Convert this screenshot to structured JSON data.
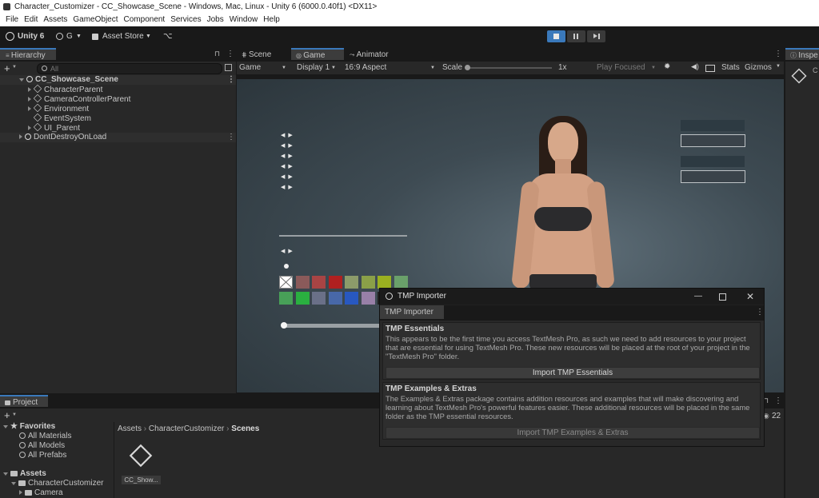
{
  "titlebar": {
    "title": "Character_Customizer - CC_Showcase_Scene - Windows, Mac, Linux - Unity 6 (6000.0.40f1) <DX11>"
  },
  "menu": [
    "File",
    "Edit",
    "Assets",
    "GameObject",
    "Component",
    "Services",
    "Jobs",
    "Window",
    "Help"
  ],
  "toolbar": {
    "unity_label": "Unity 6",
    "account_label": "G",
    "asset_store_label": "Asset Store"
  },
  "hierarchy": {
    "tab_label": "Hierarchy",
    "search_placeholder": "All",
    "scene_name": "CC_Showcase_Scene",
    "children": [
      "CharacterParent",
      "CameraControllerParent",
      "Environment",
      "EventSystem",
      "UI_Parent"
    ],
    "dont_destroy": "DontDestroyOnLoad"
  },
  "view_tabs": [
    "Scene",
    "Game",
    "Animator"
  ],
  "game_toolbar": {
    "mode": "Game",
    "display": "Display 1",
    "aspect": "16:9 Aspect",
    "scale_label": "Scale",
    "scale_value": "1x",
    "play_focused": "Play Focused",
    "stats": "Stats",
    "gizmos": "Gizmos"
  },
  "game_ui": {
    "swatch_colors_row1": [
      "#ffffff",
      "#8a5a5a",
      "#a84444",
      "#b02020",
      "#8c9b6a",
      "#8aa048",
      "#9ab020",
      "#6aa06a"
    ],
    "swatch_colors_row2": [
      "#48a058",
      "#2ab040",
      "#6a7088",
      "#4868a8",
      "#2858c0",
      "#9880a8",
      "#202020",
      "#202020"
    ]
  },
  "inspector": {
    "tab_label": "Inspe"
  },
  "project": {
    "tab_label": "Project",
    "favorites_label": "Favorites",
    "favorites": [
      "All Materials",
      "All Models",
      "All Prefabs"
    ],
    "assets_label": "Assets",
    "tree": [
      "CharacterCustomizer",
      "Camera"
    ],
    "breadcrumb": [
      "Assets",
      "CharacterCustomizer",
      "Scenes"
    ],
    "file_label": "CC_Show...",
    "count": "22"
  },
  "tmp_dialog": {
    "title": "TMP Importer",
    "tab": "TMP Importer",
    "essentials_header": "TMP Essentials",
    "essentials_text": "This appears to be the first time you access TextMesh Pro, as such we need to add resources to your project that are essential for using TextMesh Pro. These new resources will be placed at the root of your project in the \"TextMesh Pro\" folder.",
    "essentials_button": "Import TMP Essentials",
    "extras_header": "TMP Examples & Extras",
    "extras_text": "The Examples & Extras package contains addition resources and examples that will make discovering and learning about TextMesh Pro's powerful features easier. These additional resources will be placed in the same folder as the TMP essential resources.",
    "extras_button": "Import TMP Examples & Extras"
  }
}
